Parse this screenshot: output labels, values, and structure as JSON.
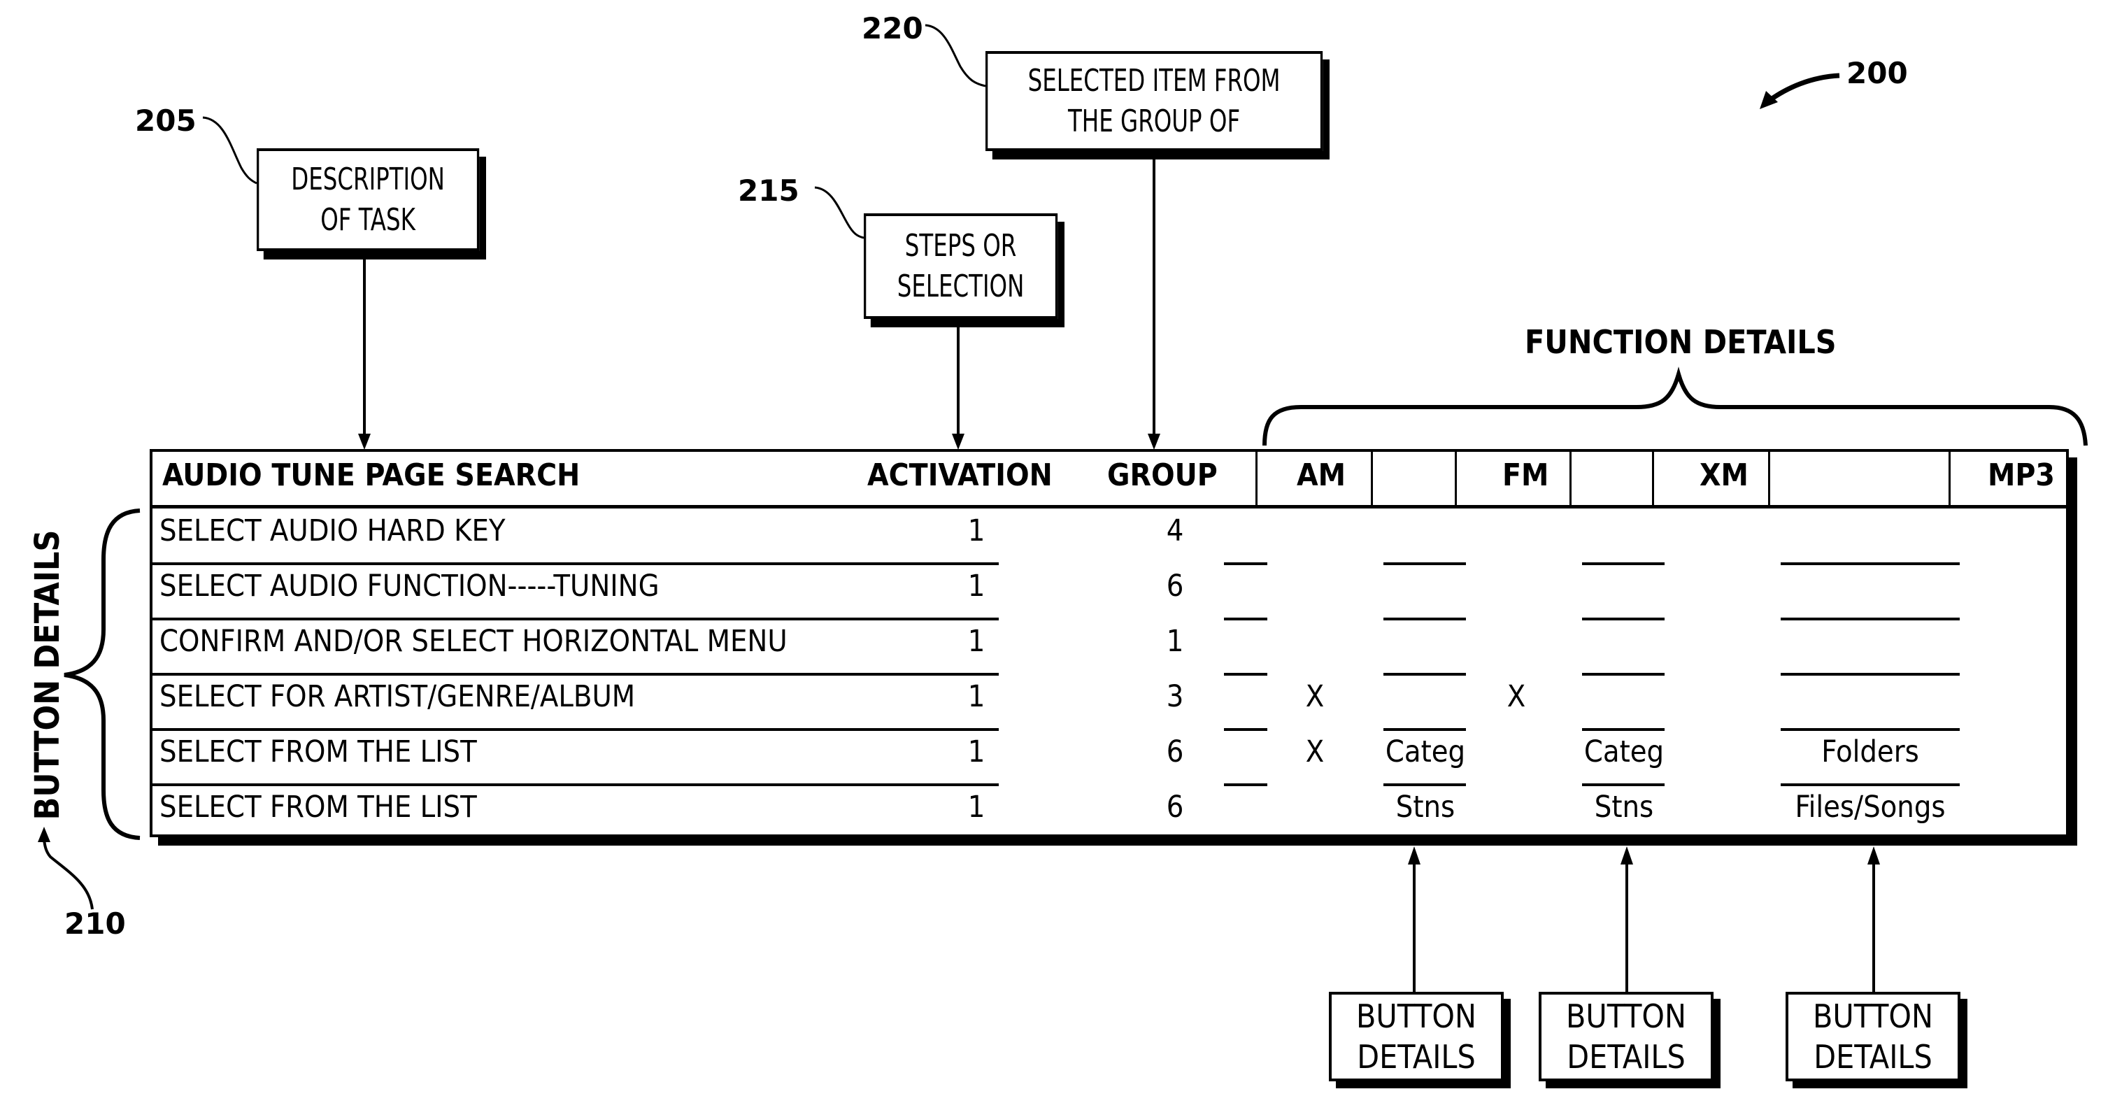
{
  "figure_ref": "200",
  "callouts": {
    "description": {
      "ref": "205",
      "lines": [
        "DESCRIPTION",
        "OF TASK"
      ]
    },
    "steps": {
      "ref": "215",
      "lines": [
        "STEPS OR",
        "SELECTION"
      ]
    },
    "selected_item": {
      "ref": "220",
      "lines": [
        "SELECTED ITEM FROM",
        "THE GROUP OF"
      ]
    }
  },
  "function_details_label": "FUNCTION DETAILS",
  "button_details_side": {
    "label": "BUTTON DETAILS",
    "ref": "210"
  },
  "table": {
    "headers": {
      "task": "AUDIO TUNE PAGE SEARCH",
      "activation": "ACTIVATION",
      "group": "GROUP",
      "am": "AM",
      "fm": "FM",
      "xm": "XM",
      "mp3": "MP3"
    },
    "rows": [
      {
        "task": "SELECT AUDIO HARD KEY",
        "activation": "1",
        "group": "4",
        "am": "",
        "am_detail": "",
        "fm": "",
        "fm_detail": "",
        "mp3_detail": ""
      },
      {
        "task": "SELECT AUDIO FUNCTION-----TUNING",
        "activation": "1",
        "group": "6",
        "am": "",
        "am_detail": "",
        "fm": "",
        "fm_detail": "",
        "mp3_detail": ""
      },
      {
        "task": "CONFIRM AND/OR SELECT HORIZONTAL MENU",
        "activation": "1",
        "group": "1",
        "am": "",
        "am_detail": "",
        "fm": "",
        "fm_detail": "",
        "mp3_detail": ""
      },
      {
        "task": "SELECT FOR ARTIST/GENRE/ALBUM",
        "activation": "1",
        "group": "3",
        "am": "X",
        "am_detail": "",
        "fm": "X",
        "fm_detail": "",
        "mp3_detail": ""
      },
      {
        "task": "SELECT FROM THE LIST",
        "activation": "1",
        "group": "6",
        "am": "X",
        "am_detail": "Categ",
        "fm": "",
        "fm_detail": "Categ",
        "mp3_detail": "Folders"
      },
      {
        "task": "SELECT FROM THE LIST",
        "activation": "1",
        "group": "6",
        "am": "",
        "am_detail": "Stns",
        "fm": "",
        "fm_detail": "Stns",
        "mp3_detail": "Files/Songs"
      }
    ]
  },
  "bottom_boxes": [
    {
      "lines": [
        "BUTTON",
        "DETAILS"
      ]
    },
    {
      "lines": [
        "BUTTON",
        "DETAILS"
      ]
    },
    {
      "lines": [
        "BUTTON",
        "DETAILS"
      ]
    }
  ]
}
